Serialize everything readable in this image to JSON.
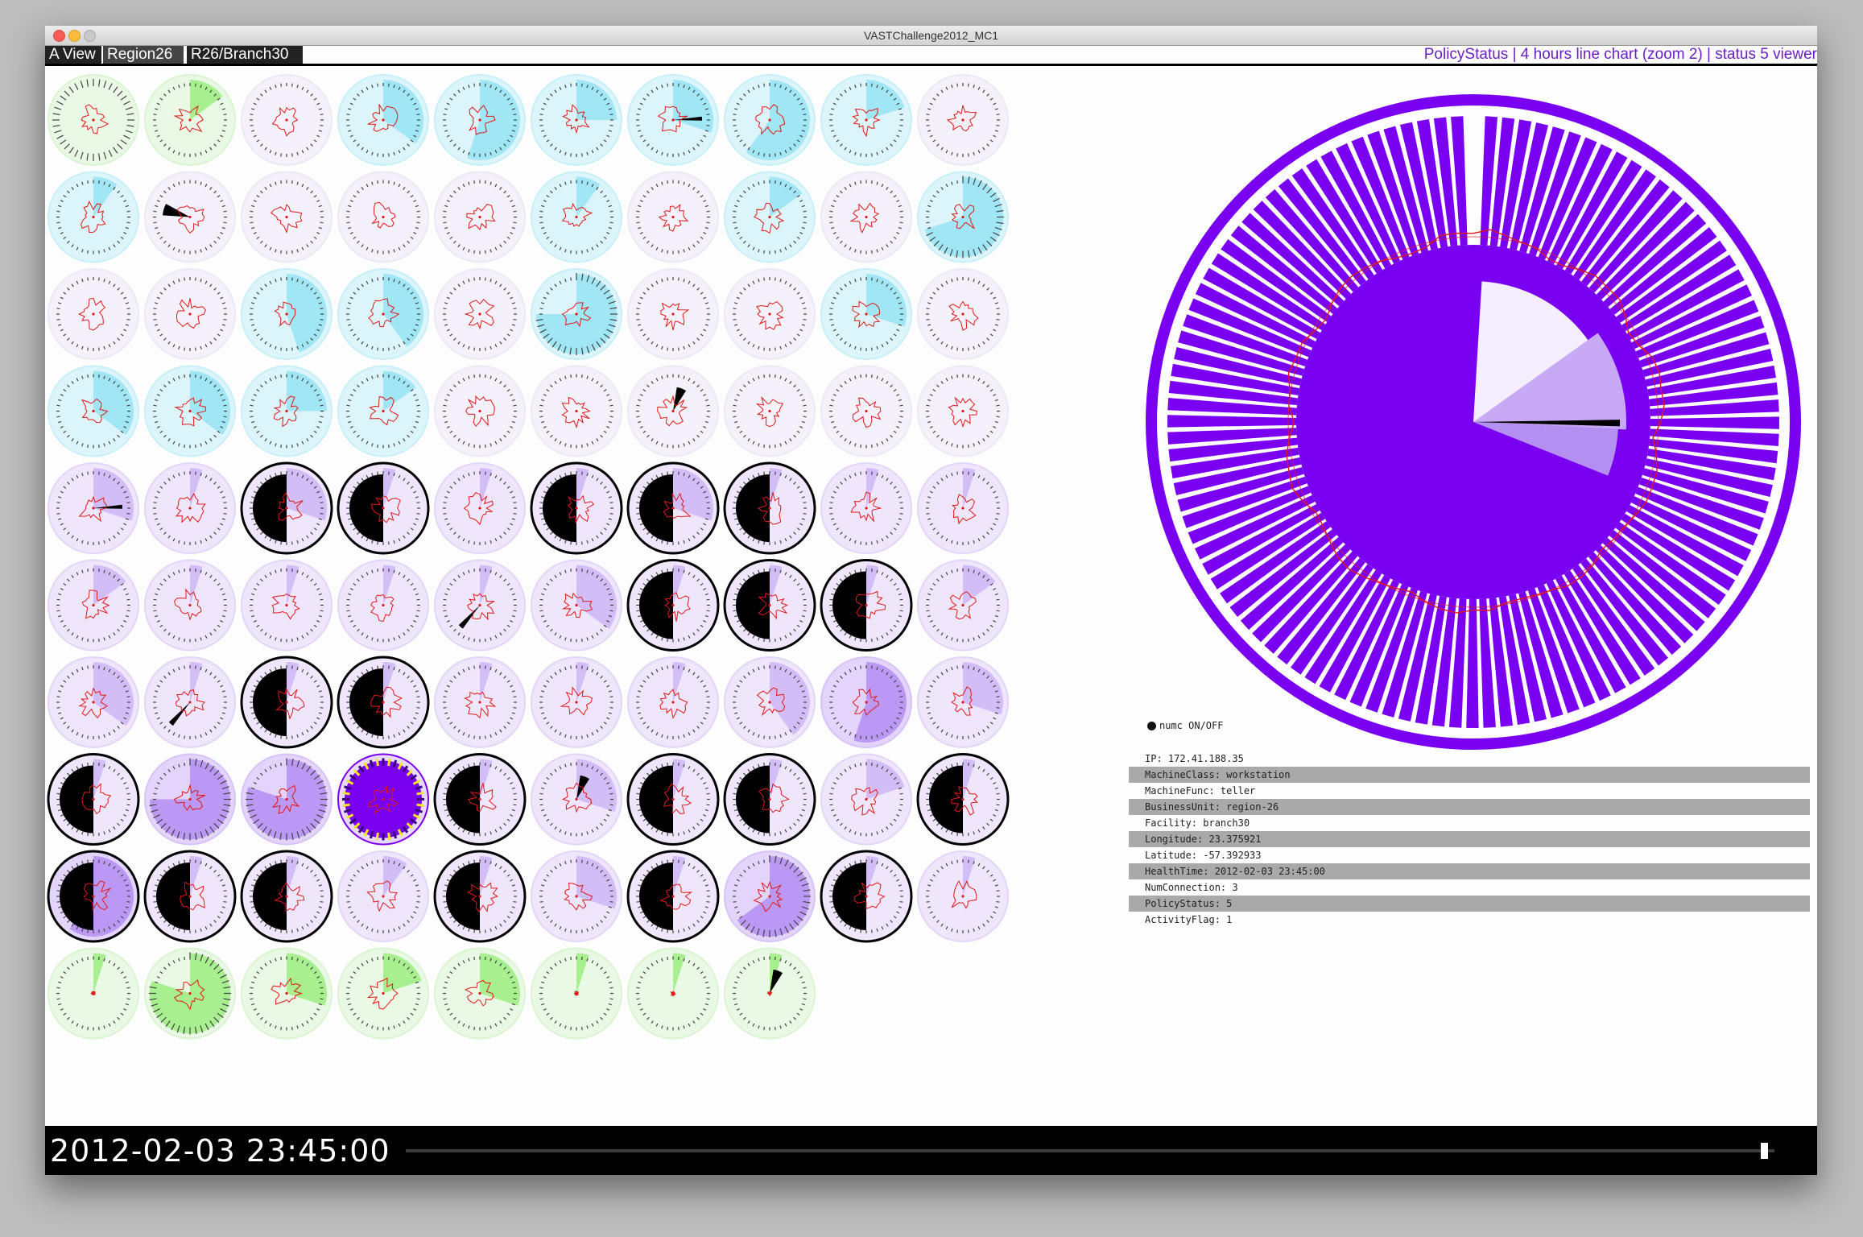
{
  "window": {
    "title": "VASTChallenge2012_MC1",
    "controls": [
      "close",
      "minimize",
      "maximize"
    ]
  },
  "toolbar": {
    "breadcrumbs": [
      {
        "label": "A View"
      },
      {
        "label": "Region26"
      },
      {
        "label": "R26/Branch30"
      }
    ],
    "status_text": "PolicyStatus | 4 hours line chart (zoom 2) | status 5 viewer"
  },
  "colors": {
    "status1": "#71e84a",
    "status2": "#6fd8ef",
    "status3": "#b99bf1",
    "status4": "#9a66ee",
    "status5": "#7a00f2",
    "line": "#e01818",
    "highlight": "#f5e61e"
  },
  "machine_grid": {
    "rows": 10,
    "cols": 10,
    "cells": [
      {
        "status": 1,
        "level": 1.0,
        "off": null,
        "spikes": false
      },
      {
        "status": 1,
        "level": 0.15,
        "off": null,
        "spikes": false
      },
      {
        "status": 0,
        "level": 0.0,
        "off": null,
        "spikes": false
      },
      {
        "status": 2,
        "level": 0.35,
        "off": null,
        "spikes": false
      },
      {
        "status": 2,
        "level": 0.55,
        "off": null,
        "spikes": false
      },
      {
        "status": 2,
        "level": 0.25,
        "off": null,
        "spikes": false
      },
      {
        "status": 2,
        "level": 0.3,
        "off": "ray",
        "spikes": false
      },
      {
        "status": 2,
        "level": 0.6,
        "off": null,
        "spikes": false
      },
      {
        "status": 2,
        "level": 0.2,
        "off": null,
        "spikes": false
      },
      {
        "status": 0,
        "level": 0.0,
        "off": null,
        "spikes": false
      },
      {
        "status": 2,
        "level": 0.1,
        "off": null,
        "spikes": false
      },
      {
        "status": 0,
        "level": 0.0,
        "off": "wedge-left",
        "spikes": false
      },
      {
        "status": 0,
        "level": 0.0,
        "off": null,
        "spikes": false
      },
      {
        "status": 0,
        "level": 0.0,
        "off": null,
        "spikes": false
      },
      {
        "status": 0,
        "level": 0.0,
        "off": null,
        "spikes": false
      },
      {
        "status": 2,
        "level": 0.1,
        "off": null,
        "spikes": false
      },
      {
        "status": 0,
        "level": 0.0,
        "off": null,
        "spikes": false
      },
      {
        "status": 2,
        "level": 0.15,
        "off": null,
        "spikes": false
      },
      {
        "status": 0,
        "level": 0.0,
        "off": null,
        "spikes": false
      },
      {
        "status": 2,
        "level": 0.7,
        "off": null,
        "spikes": false
      },
      {
        "status": 0,
        "level": 0.0,
        "off": null,
        "spikes": false
      },
      {
        "status": 0,
        "level": 0.0,
        "off": null,
        "spikes": false
      },
      {
        "status": 2,
        "level": 0.45,
        "off": null,
        "spikes": false
      },
      {
        "status": 2,
        "level": 0.4,
        "off": null,
        "spikes": false
      },
      {
        "status": 0,
        "level": 0.0,
        "off": null,
        "spikes": false
      },
      {
        "status": 2,
        "level": 0.75,
        "off": null,
        "spikes": false
      },
      {
        "status": 0,
        "level": 0.0,
        "off": null,
        "spikes": false
      },
      {
        "status": 0,
        "level": 0.0,
        "off": null,
        "spikes": false
      },
      {
        "status": 2,
        "level": 0.3,
        "off": null,
        "spikes": false
      },
      {
        "status": 0,
        "level": 0.0,
        "off": null,
        "spikes": false
      },
      {
        "status": 2,
        "level": 0.35,
        "off": null,
        "spikes": false
      },
      {
        "status": 2,
        "level": 0.35,
        "off": null,
        "spikes": false
      },
      {
        "status": 2,
        "level": 0.25,
        "off": null,
        "spikes": false
      },
      {
        "status": 2,
        "level": 0.15,
        "off": null,
        "spikes": false
      },
      {
        "status": 0,
        "level": 0.0,
        "off": null,
        "spikes": false
      },
      {
        "status": 0,
        "level": 0.0,
        "off": null,
        "spikes": false
      },
      {
        "status": 0,
        "level": 0.0,
        "off": "wedge-top",
        "spikes": false
      },
      {
        "status": 0,
        "level": 0.0,
        "off": null,
        "spikes": false
      },
      {
        "status": 0,
        "level": 0.0,
        "off": null,
        "spikes": false
      },
      {
        "status": 0,
        "level": 0.0,
        "off": null,
        "spikes": false
      },
      {
        "status": 3,
        "level": 0.3,
        "off": "ray",
        "spikes": false
      },
      {
        "status": 3,
        "level": 0.05,
        "off": null,
        "spikes": false
      },
      {
        "status": 3,
        "level": 0.3,
        "off": "half",
        "spikes": false
      },
      {
        "status": 3,
        "level": 0.05,
        "off": "half",
        "spikes": false
      },
      {
        "status": 3,
        "level": 0.05,
        "off": null,
        "spikes": false
      },
      {
        "status": 3,
        "level": 0.05,
        "off": "half",
        "spikes": false
      },
      {
        "status": 3,
        "level": 0.3,
        "off": "half",
        "spikes": false
      },
      {
        "status": 3,
        "level": 0.05,
        "off": "half",
        "spikes": false
      },
      {
        "status": 3,
        "level": 0.05,
        "off": null,
        "spikes": false
      },
      {
        "status": 3,
        "level": 0.05,
        "off": null,
        "spikes": false
      },
      {
        "status": 3,
        "level": 0.15,
        "off": null,
        "spikes": false
      },
      {
        "status": 3,
        "level": 0.05,
        "off": null,
        "spikes": false
      },
      {
        "status": 3,
        "level": 0.05,
        "off": null,
        "spikes": false
      },
      {
        "status": 3,
        "level": 0.05,
        "off": null,
        "spikes": false
      },
      {
        "status": 3,
        "level": 0.05,
        "off": "ray-low",
        "spikes": false
      },
      {
        "status": 3,
        "level": 0.35,
        "off": null,
        "spikes": false
      },
      {
        "status": 3,
        "level": 0.05,
        "off": "half",
        "spikes": false
      },
      {
        "status": 3,
        "level": 0.05,
        "off": "half",
        "spikes": false
      },
      {
        "status": 3,
        "level": 0.05,
        "off": "half",
        "spikes": false
      },
      {
        "status": 3,
        "level": 0.15,
        "off": null,
        "spikes": false
      },
      {
        "status": 3,
        "level": 0.35,
        "off": null,
        "spikes": false
      },
      {
        "status": 3,
        "level": 0.05,
        "off": "ray-low",
        "spikes": false
      },
      {
        "status": 3,
        "level": 0.05,
        "off": "half",
        "spikes": false
      },
      {
        "status": 3,
        "level": 0.05,
        "off": "half",
        "spikes": false
      },
      {
        "status": 3,
        "level": 0.05,
        "off": null,
        "spikes": false
      },
      {
        "status": 3,
        "level": 0.05,
        "off": null,
        "spikes": false
      },
      {
        "status": 3,
        "level": 0.05,
        "off": null,
        "spikes": false
      },
      {
        "status": 3,
        "level": 0.4,
        "off": null,
        "spikes": false
      },
      {
        "status": 4,
        "level": 0.55,
        "off": null,
        "spikes": false
      },
      {
        "status": 3,
        "level": 0.3,
        "off": null,
        "spikes": false
      },
      {
        "status": 3,
        "level": 0.05,
        "off": "half",
        "spikes": false
      },
      {
        "status": 4,
        "level": 0.75,
        "off": null,
        "spikes": false
      },
      {
        "status": 4,
        "level": 0.8,
        "off": null,
        "spikes": false
      },
      {
        "status": 5,
        "level": 1.0,
        "off": null,
        "spikes": true
      },
      {
        "status": 3,
        "level": 0.05,
        "off": "half",
        "spikes": false
      },
      {
        "status": 3,
        "level": 0.3,
        "off": "wedge-top",
        "spikes": false
      },
      {
        "status": 3,
        "level": 0.05,
        "off": "half",
        "spikes": false
      },
      {
        "status": 3,
        "level": 0.05,
        "off": "half",
        "spikes": false
      },
      {
        "status": 3,
        "level": 0.2,
        "off": null,
        "spikes": false
      },
      {
        "status": 3,
        "level": 0.05,
        "off": "half",
        "spikes": false
      },
      {
        "status": 4,
        "level": 0.6,
        "off": "half",
        "spikes": false
      },
      {
        "status": 3,
        "level": 0.05,
        "off": "half",
        "spikes": false
      },
      {
        "status": 3,
        "level": 0.05,
        "off": "half",
        "spikes": false
      },
      {
        "status": 3,
        "level": 0.1,
        "off": null,
        "spikes": false
      },
      {
        "status": 3,
        "level": 0.05,
        "off": "half",
        "spikes": false
      },
      {
        "status": 3,
        "level": 0.3,
        "off": null,
        "spikes": false
      },
      {
        "status": 3,
        "level": 0.05,
        "off": "half",
        "spikes": false
      },
      {
        "status": 4,
        "level": 0.65,
        "off": null,
        "spikes": false
      },
      {
        "status": 3,
        "level": 0.05,
        "off": "half",
        "spikes": false
      },
      {
        "status": 3,
        "level": 0.05,
        "off": null,
        "spikes": false
      },
      {
        "status": 1,
        "level": 0.05,
        "off": null,
        "spikes": false
      },
      {
        "status": 1,
        "level": 0.8,
        "off": null,
        "spikes": false
      },
      {
        "status": 1,
        "level": 0.3,
        "off": null,
        "spikes": false
      },
      {
        "status": 1,
        "level": 0.2,
        "off": null,
        "spikes": false
      },
      {
        "status": 1,
        "level": 0.3,
        "off": null,
        "spikes": false
      },
      {
        "status": 1,
        "level": 0.05,
        "off": null,
        "spikes": false
      },
      {
        "status": 1,
        "level": 0.05,
        "off": null,
        "spikes": false
      },
      {
        "status": 1,
        "level": 0.05,
        "off": "wedge-top",
        "spikes": false
      }
    ]
  },
  "detail_view": {
    "status": 5,
    "status_color": "#7a00f2",
    "bar_count": 112,
    "inner_light": "#f4eefe",
    "inner_mid": "#c8a9f6",
    "inner_dark": "#7a00f2"
  },
  "legend": {
    "label": "numc ON/OFF"
  },
  "info": {
    "rows": [
      {
        "text": "IP: 172.41.188.35",
        "shaded": false
      },
      {
        "text": "MachineClass: workstation",
        "shaded": true
      },
      {
        "text": "MachineFunc: teller",
        "shaded": false
      },
      {
        "text": "BusinessUnit: region-26",
        "shaded": true
      },
      {
        "text": "Facility: branch30",
        "shaded": false
      },
      {
        "text": "Longitude: 23.375921",
        "shaded": true
      },
      {
        "text": "Latitude: -57.392933",
        "shaded": false
      },
      {
        "text": "HealthTime: 2012-02-03 23:45:00",
        "shaded": true
      },
      {
        "text": "NumConnection: 3",
        "shaded": false
      },
      {
        "text": "PolicyStatus: 5",
        "shaded": true
      },
      {
        "text": "ActivityFlag: 1",
        "shaded": false
      }
    ]
  },
  "timeline": {
    "current_time": "2012-02-03 23:45:00",
    "position": 0.99
  }
}
